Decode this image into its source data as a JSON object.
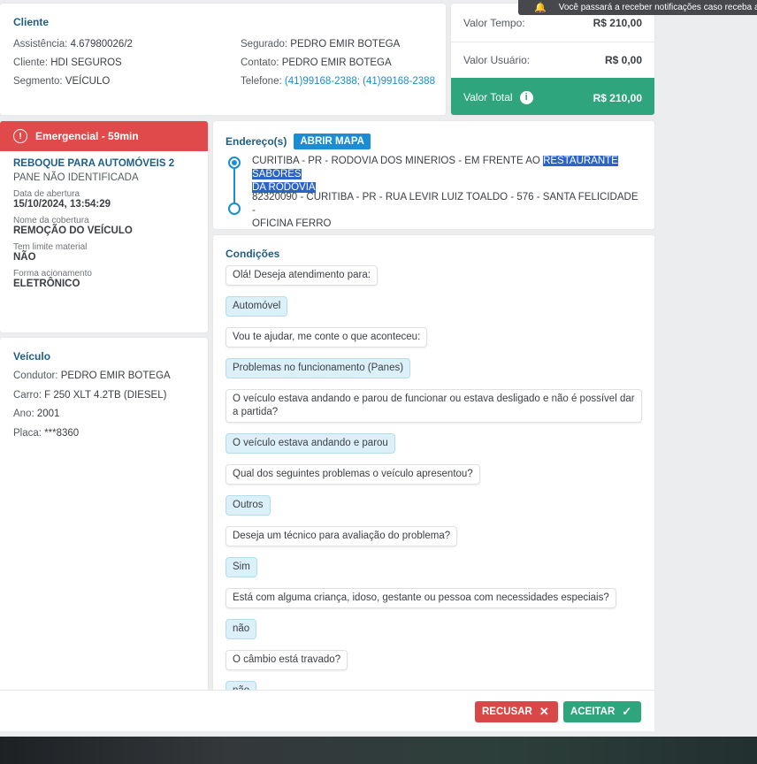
{
  "notification": {
    "text": "Você passará a receber notificações caso receba a"
  },
  "client": {
    "title": "Cliente",
    "assistencia_label": "Assistência:",
    "assistencia": "4.67980026/2",
    "cliente_label": "Cliente:",
    "cliente": "HDI SEGUROS",
    "segmento_label": "Segmento:",
    "segmento": "VEÍCULO",
    "segurado_label": "Segurado:",
    "segurado": "PEDRO EMIR BOTEGA",
    "contato_label": "Contato:",
    "contato": "PEDRO EMIR BOTEGA",
    "telefone_label": "Telefone:",
    "telefone": "(41)99168-2388; (41)99168-2388"
  },
  "values": {
    "tempo_label": "Valor Tempo:",
    "tempo": "R$ 210,00",
    "usuario_label": "Valor Usuário:",
    "usuario": "R$ 0,00",
    "total_label": "Valor Total",
    "total": "R$ 210,00",
    "total_color": "#2ea57d"
  },
  "service": {
    "badge": "Emergencial - 59min",
    "badge_color": "#e04a4a",
    "title": "REBOQUE PARA AUTOMÓVEIS 2",
    "subtitle": "PANE NÃO IDENTIFICADA",
    "data_label": "Data de abertura",
    "data": "15/10/2024, 13:54:29",
    "cobertura_label": "Nome da cobertura",
    "cobertura": "REMOÇÃO DO VEÍCULO",
    "limite_label": "Tem limite material",
    "limite": "NÃO",
    "forma_label": "Forma acionamento",
    "forma": "ELETRÔNICO"
  },
  "vehicle": {
    "title": "Veículo",
    "condutor_label": "Condutor:",
    "condutor": "PEDRO EMIR BOTEGA",
    "carro_label": "Carro:",
    "carro": "F 250 XLT 4.2TB (DIESEL)",
    "ano_label": "Ano:",
    "ano": "2001",
    "placa_label": "Placa:",
    "placa": "***8360"
  },
  "address": {
    "title": "Endereço(s)",
    "map_button": "ABRIR MAPA",
    "origin_plain": "CURITIBA - PR - RODOVIA DOS MINERIOS - EM FRENTE AO ",
    "origin_highlight_1": "RESTAURANTE SABORES",
    "origin_highlight_2": "DA RODOVIA",
    "destination_1": "82320090 - CURITIBA - PR - RUA LEVIR LUIZ TOALDO - 576 - SANTA FELICIDADE -",
    "destination_2": "OFICINA FERRO"
  },
  "conditions": {
    "title": "Condições",
    "messages": [
      {
        "type": "q",
        "text": "Olá! Deseja atendimento para:"
      },
      {
        "type": "a",
        "text": "Automóvel"
      },
      {
        "type": "q",
        "text": "Vou te ajudar, me conte o que aconteceu:"
      },
      {
        "type": "a",
        "text": "Problemas no funcionamento (Panes)"
      },
      {
        "type": "q",
        "text": "O veículo estava andando e parou de funcionar ou estava desligado e não é possível dar a partida?"
      },
      {
        "type": "a",
        "text": "O veículo estava andando e parou"
      },
      {
        "type": "q",
        "text": "Qual dos seguintes problemas o veículo apresentou?"
      },
      {
        "type": "a",
        "text": "Outros"
      },
      {
        "type": "q",
        "text": "Deseja um técnico para avaliação do problema?"
      },
      {
        "type": "a",
        "text": "Sim"
      },
      {
        "type": "q",
        "text": "Está com alguma criança, idoso, gestante ou pessoa com necessidades especiais?"
      },
      {
        "type": "a",
        "text": "não"
      },
      {
        "type": "q",
        "text": "O câmbio está travado?"
      },
      {
        "type": "a",
        "text": "não"
      }
    ]
  },
  "actions": {
    "refuse": "RECUSAR",
    "refuse_icon": "close-icon",
    "refuse_color": "#d94848",
    "accept": "ACEITAR",
    "accept_icon": "check-icon",
    "accept_color": "#2ea57d"
  }
}
